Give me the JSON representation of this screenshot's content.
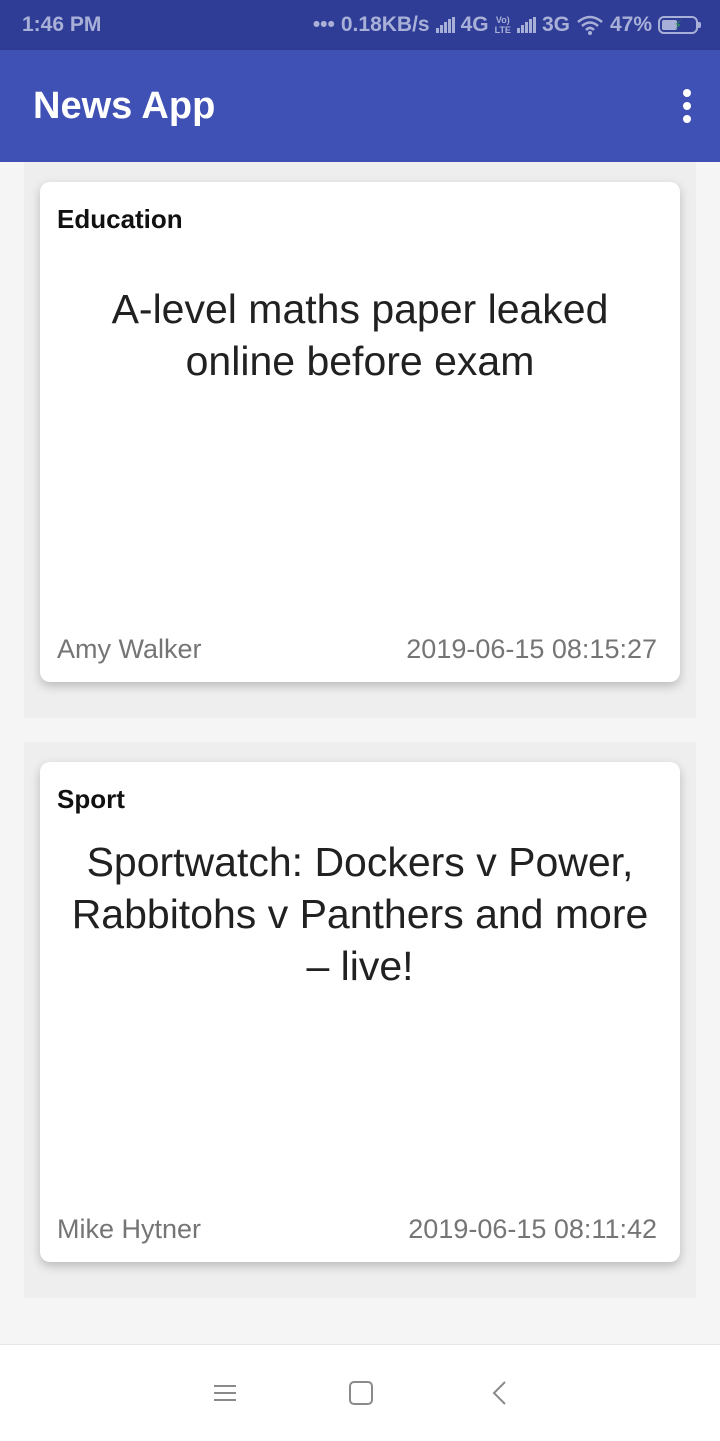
{
  "status_bar": {
    "time": "1:46 PM",
    "dots": "•••",
    "speed": "0.18KB/s",
    "network1": "4G",
    "volte_top": "Vo)",
    "volte_bottom": "LTE",
    "network2": "3G",
    "battery_percent": "47%",
    "battery_level": 0.47,
    "color": "#a9b0d8"
  },
  "app_bar": {
    "title": "News App",
    "menu_icon": "more-vert-icon",
    "color": "#3f51b5"
  },
  "articles": [
    {
      "category": "Education",
      "headline": "A-level maths paper leaked online before exam",
      "author": "Amy Walker",
      "datetime": "2019-06-15 08:15:27"
    },
    {
      "category": "Sport",
      "headline": "Sportwatch: Dockers v Power, Rabbitohs v Panthers and more – live!",
      "author": "Mike Hytner",
      "datetime": "2019-06-15 08:11:42"
    }
  ],
  "nav_bar": {
    "icons": [
      "menu-icon",
      "home-square-icon",
      "back-chevron-icon"
    ]
  }
}
